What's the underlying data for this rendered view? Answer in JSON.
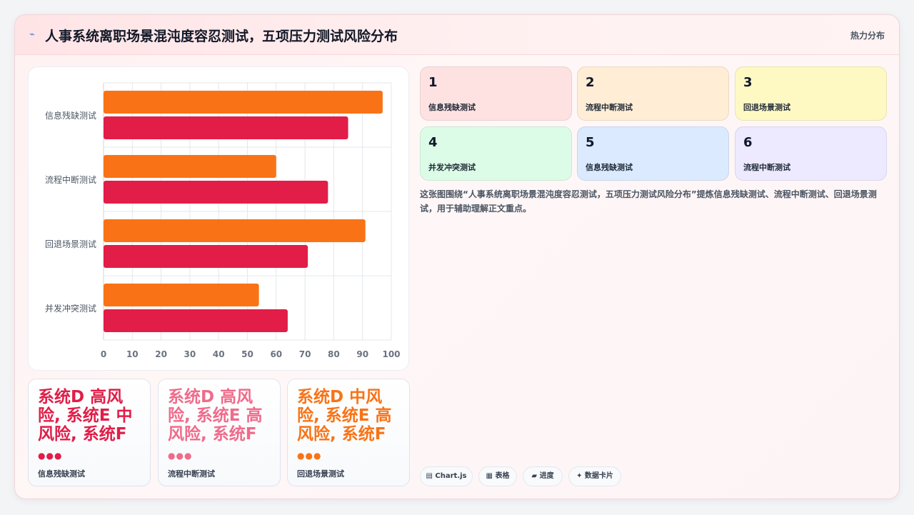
{
  "header": {
    "icon": "lightning-icon",
    "title": "人事系统离职场景混沌度容忍测试，五项压力测试风险分布",
    "badge": "热力分布"
  },
  "chart_data": {
    "type": "bar",
    "orientation": "horizontal",
    "categories": [
      "信息残缺测试",
      "流程中断测试",
      "回退场景测试",
      "并发冲突测试"
    ],
    "series": [
      {
        "color": "#f97316",
        "values": [
          97,
          60,
          91,
          54
        ]
      },
      {
        "color": "#e11d48",
        "values": [
          85,
          78,
          71,
          64
        ]
      }
    ],
    "xlim": [
      0,
      100
    ],
    "xticks": [
      0,
      10,
      20,
      30,
      40,
      50,
      60,
      70,
      80,
      90,
      100
    ],
    "grid": true
  },
  "kpis": [
    {
      "text": "系统D 高风险, 系统E 中风险, 系统F",
      "dots": "●●●",
      "label": "信息残缺测试",
      "color": "#e11d48"
    },
    {
      "text": "系统D 高风险, 系统E 高风险, 系统F",
      "dots": "●●●",
      "label": "流程中断测试",
      "color": "#f06b8a"
    },
    {
      "text": "系统D 中风险, 系统E 高风险, 系统F",
      "dots": "●●●",
      "label": "回退场景测试",
      "color": "#f97316"
    }
  ],
  "tiles": [
    {
      "num": "1",
      "label": "信息残缺测试",
      "bg": "#fee2e2"
    },
    {
      "num": "2",
      "label": "流程中断测试",
      "bg": "#ffedd5"
    },
    {
      "num": "3",
      "label": "回退场景测试",
      "bg": "#fef9c3"
    },
    {
      "num": "4",
      "label": "并发冲突测试",
      "bg": "#dcfce7"
    },
    {
      "num": "5",
      "label": "信息残缺测试",
      "bg": "#dbeafe"
    },
    {
      "num": "6",
      "label": "流程中断测试",
      "bg": "#ede9fe"
    }
  ],
  "description": "这张图围绕“人事系统离职场景混沌度容忍测试，五项压力测试风险分布”提炼信息残缺测试、流程中断测试、回退场景测试，用于辅助理解正文重点。",
  "tags": [
    {
      "icon": "chart-icon",
      "label": "▤ Chart.js"
    },
    {
      "icon": "table-icon",
      "label": "▦ 表格"
    },
    {
      "icon": "progress-icon",
      "label": "▰ 进度"
    },
    {
      "icon": "sparkle-icon",
      "label": "✦ 数据卡片"
    }
  ]
}
